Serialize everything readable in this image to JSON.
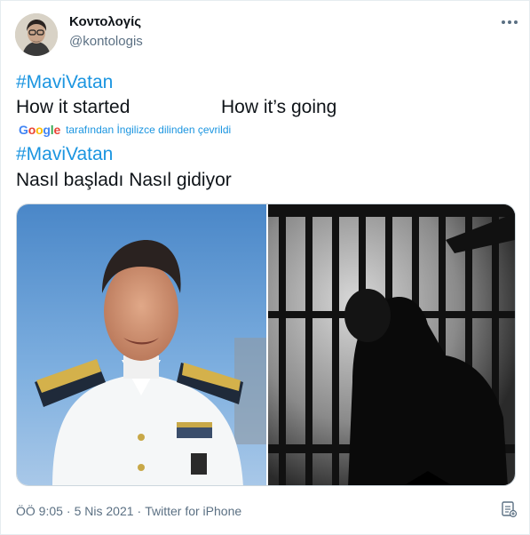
{
  "author": {
    "display_name": "Κοντολογίς",
    "handle": "@kontologis"
  },
  "original": {
    "hashtag": "#MaviVatan",
    "text_left": "How it started",
    "text_right": "How it’s going"
  },
  "translation": {
    "brand": "Google",
    "note": "tarafından İngilizce dilinden çevrildi"
  },
  "translated": {
    "hashtag": "#MaviVatan",
    "text": "Nasıl başladı Nasıl gidiyor"
  },
  "footer": {
    "time": "ÖÖ 9:05",
    "separator1": "·",
    "date": "5 Nis 2021",
    "separator2": "·",
    "source": "Twitter for iPhone"
  },
  "icons": {
    "more": "more-horizontal-icon",
    "analytics": "analytics-icon"
  },
  "colors": {
    "link": "#1b95e0",
    "text": "#0f1419",
    "muted": "#5b7083"
  }
}
